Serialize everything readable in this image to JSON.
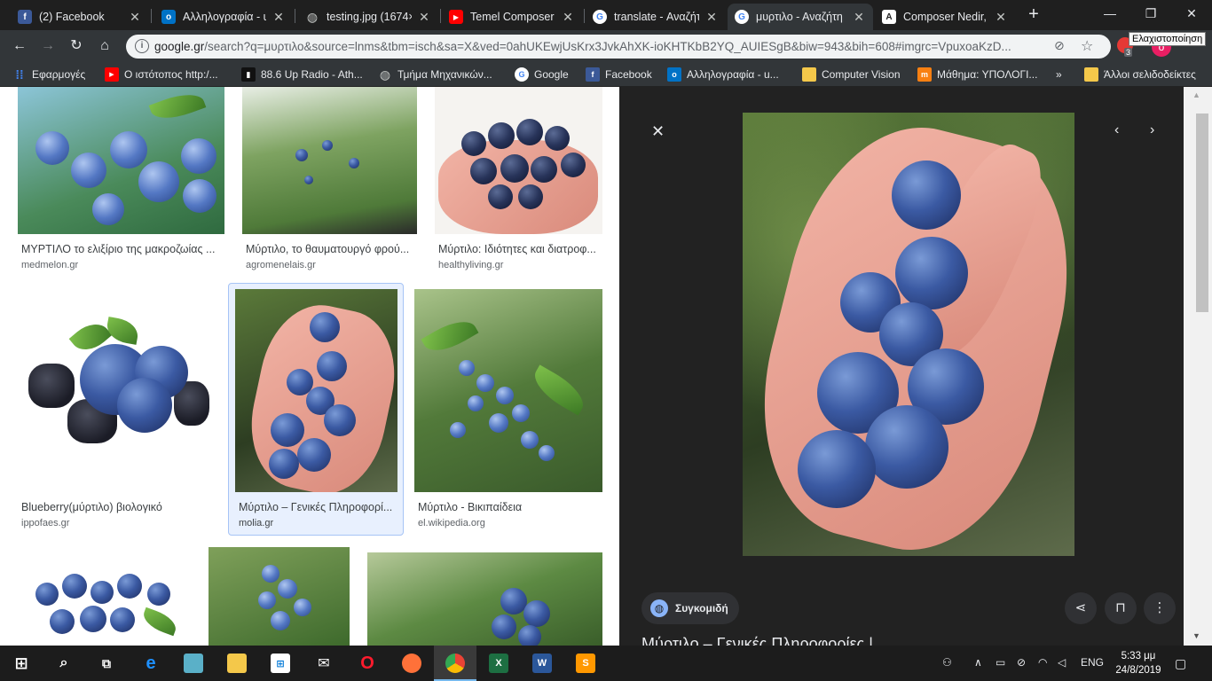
{
  "tabs": [
    {
      "title": "(2) Facebook",
      "icon": "facebook-icon",
      "color": "#3b5998",
      "glyph": "f"
    },
    {
      "title": "Αλληλογραφία - u",
      "icon": "outlook-icon",
      "color": "#0072c6",
      "glyph": "o"
    },
    {
      "title": "testing.jpg (1674×",
      "icon": "globe-icon",
      "color": "#5f6368",
      "glyph": "◍"
    },
    {
      "title": "Temel Composer K",
      "icon": "youtube-icon",
      "color": "#ff0000",
      "glyph": "▶"
    },
    {
      "title": "translate - Αναζήτ",
      "icon": "google-icon",
      "color": "#4285f4",
      "glyph": "G"
    },
    {
      "title": "μυρτιλο - Αναζήτη",
      "icon": "google-icon",
      "color": "#4285f4",
      "glyph": "G"
    },
    {
      "title": "Composer Nedir, N",
      "icon": "composer-icon",
      "color": "#222222",
      "glyph": "A"
    }
  ],
  "address": {
    "host": "google.gr",
    "path": "/search?q=μυρτιλο&source=lnms&tbm=isch&sa=X&ved=0ahUKEwjUsKrx3JvkAhXK-ioKHTKbB2YQ_AUIESgB&biw=943&bih=608#imgrc=VpuxoaKzD..."
  },
  "tooltip": "Ελαχιστοποίηση",
  "extension_badge": "3",
  "bookmarks": [
    {
      "label": "Εφαρμογές",
      "icon": "apps-grid-icon",
      "color": "#4285f4",
      "glyph": "⁞⁞"
    },
    {
      "label": "Ο ιστότοπος http:/...",
      "icon": "youtube-icon",
      "color": "#ff0000",
      "glyph": "▶"
    },
    {
      "label": "88.6 Up Radio - Ath...",
      "icon": "radio-icon",
      "color": "#111111",
      "glyph": "▮"
    },
    {
      "label": "Τμήμα Μηχανικών...",
      "icon": "globe-icon",
      "color": "#5f6368",
      "glyph": "◍"
    },
    {
      "label": "Google",
      "icon": "google-icon",
      "color": "#4285f4",
      "glyph": "G"
    },
    {
      "label": "Facebook",
      "icon": "facebook-icon",
      "color": "#3b5998",
      "glyph": "f"
    },
    {
      "label": "Αλληλογραφία - u...",
      "icon": "outlook-icon",
      "color": "#0072c6",
      "glyph": "o"
    },
    {
      "label": "Computer Vision",
      "icon": "folder-icon",
      "color": "#f4c84a",
      "glyph": ""
    },
    {
      "label": "Μάθημα: ΥΠΟΛΟΓΙ...",
      "icon": "moodle-icon",
      "color": "#f98012",
      "glyph": "m"
    }
  ],
  "bookmarks_more": "»",
  "other_bookmarks": "Άλλοι σελιδοδείκτες",
  "results": [
    {
      "caption": "ΜΥΡΤΙΛΟ το ελιξίριο της μακροζωίας ...",
      "source": "medmelon.gr"
    },
    {
      "caption": "Μύρτιλο, το θαυματουργό φρού...",
      "source": "agromenelais.gr"
    },
    {
      "caption": "Μύρτιλο: Ιδιότητες και διατροφ...",
      "source": "healthyliving.gr"
    },
    {
      "caption": "Blueberry(μύρτιλο) βιολογικό",
      "source": "ippofaes.gr"
    },
    {
      "caption": "Μύρτιλο – Γενικές Πληροφορί...",
      "source": "molia.gr"
    },
    {
      "caption": "Μύρτιλο - Βικιπαίδεια",
      "source": "el.wikipedia.org"
    }
  ],
  "panel": {
    "collect_label": "Συγκομιδή",
    "title": "Μύρτιλο – Γενικές Πληροφορίες |"
  },
  "taskbar": {
    "language": "ENG",
    "time": "5:33 μμ",
    "date": "24/8/2019"
  }
}
